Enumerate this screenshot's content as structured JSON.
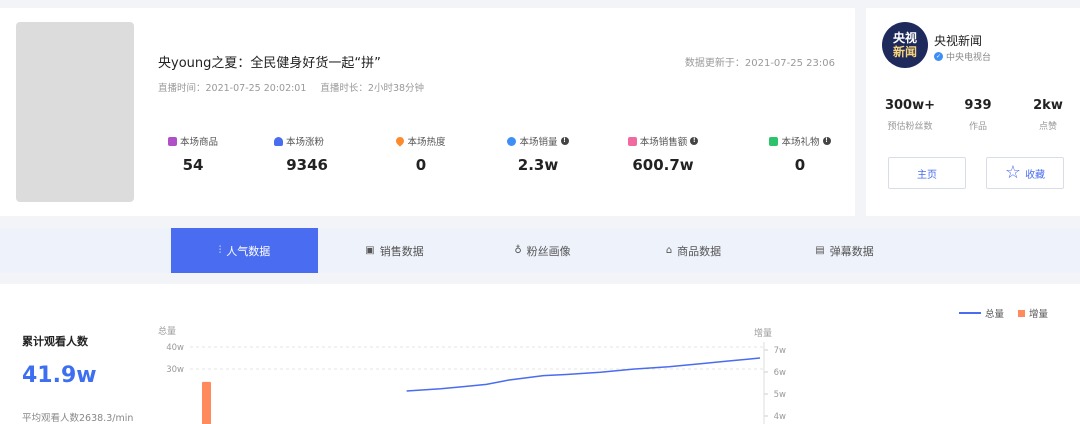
{
  "live": {
    "title": "央young之夏：全民健身好货一起“拼”",
    "update_time": "数据更新于：2021-07-25 23:06",
    "start_time": "直播时间：2021-07-25 20:02:01",
    "duration": "直播时长：2小时38分钟",
    "stats": [
      {
        "label": "本场商品",
        "value": "54",
        "icon": "shopping-bag-icon",
        "color": "#b050c8"
      },
      {
        "label": "本场涨粉",
        "value": "9346",
        "icon": "user-add-icon",
        "color": "#4a6cf0"
      },
      {
        "label": "本场热度",
        "value": "0",
        "icon": "flame-icon",
        "color": "#ff8a2a"
      },
      {
        "label": "本场销量",
        "value": "2.3w",
        "icon": "sales-icon",
        "color": "#3d8ef5"
      },
      {
        "label": "本场销售额",
        "value": "600.7w",
        "icon": "money-bag-icon",
        "color": "#f06aa0"
      },
      {
        "label": "本场礼物",
        "value": "0",
        "icon": "gift-icon",
        "color": "#2cc36b"
      }
    ]
  },
  "account": {
    "logo_line1": "央视",
    "logo_line2": "新闻",
    "name": "央视新闻",
    "subtitle": "中央电视台",
    "stats": [
      {
        "value": "300w+",
        "label": "预估粉丝数"
      },
      {
        "value": "939",
        "label": "作品"
      },
      {
        "value": "2kw",
        "label": "点赞"
      }
    ],
    "home_label": "主页",
    "fav_label": "收藏"
  },
  "tabs": [
    {
      "label": "人气数据",
      "icon": "chart-bars-icon",
      "active": true
    },
    {
      "label": "销售数据",
      "icon": "receipt-icon",
      "active": false
    },
    {
      "label": "粉丝画像",
      "icon": "fans-icon",
      "active": false
    },
    {
      "label": "商品数据",
      "icon": "bag-icon",
      "active": false
    },
    {
      "label": "弹幕数据",
      "icon": "message-icon",
      "active": false
    }
  ],
  "panel": {
    "legend_total": "总量",
    "legend_increment": "增量",
    "kpi_label": "累计观看人数",
    "kpi_value": "41.9w",
    "kpi_sub": "平均观看人数2638.3/min"
  },
  "chart_data": {
    "type": "line",
    "left_axis_label": "总量",
    "right_axis_label": "增量",
    "left_ticks": [
      "40w",
      "30w"
    ],
    "right_ticks": [
      "7w",
      "6w",
      "5w",
      "4w"
    ],
    "ylim_left": [
      0,
      40
    ],
    "ylim_right": [
      0,
      7
    ],
    "series": [
      {
        "name": "总量",
        "axis": "left",
        "color": "#4a6cf0",
        "x": [
          0.38,
          0.44,
          0.48,
          0.52,
          0.56,
          0.62,
          0.66,
          0.72,
          0.78,
          0.84,
          0.9,
          0.94,
          0.98,
          1.0
        ],
        "values": [
          20,
          21,
          22,
          23,
          25,
          27,
          27.5,
          28.5,
          30,
          31,
          32.5,
          33.5,
          34.5,
          35
        ]
      },
      {
        "name": "增量",
        "axis": "right",
        "color": "#ff8a5c",
        "type": "bar",
        "x": [
          0.085
        ],
        "values": [
          5.55
        ]
      }
    ]
  }
}
